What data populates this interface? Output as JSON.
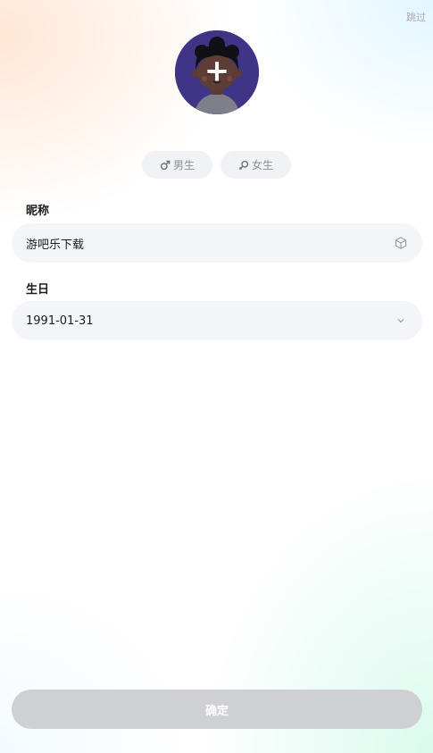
{
  "header": {
    "skip_label": "跳过"
  },
  "avatar": {
    "add_icon": "plus-icon",
    "avatar_bg": "#3f3486"
  },
  "gender": {
    "male_label": "男生",
    "female_label": "女生",
    "male_icon": "male-symbol-icon",
    "female_icon": "female-symbol-icon"
  },
  "nickname": {
    "label": "昵称",
    "value": "游吧乐下载",
    "icon": "dice-icon"
  },
  "birthday": {
    "label": "生日",
    "value": "1991-01-31",
    "icon": "chevron-down-icon"
  },
  "footer": {
    "confirm_label": "确定",
    "confirm_color": "#cfd0d4"
  }
}
